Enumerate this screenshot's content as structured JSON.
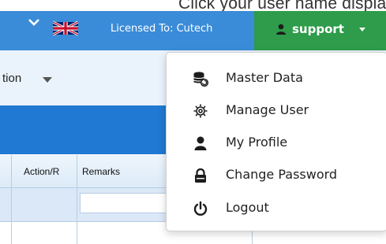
{
  "caption": {
    "text": "Click your user name displayed on"
  },
  "header": {
    "licensed_text": "Licensed To: Cutech",
    "user_label": "support",
    "colors": {
      "topbar": "#3a8cd8",
      "user_button": "#2e9c4a"
    }
  },
  "navbar": {
    "partial_label": "tion"
  },
  "table": {
    "columns": [
      "Action/R",
      "Remarks"
    ]
  },
  "menu": {
    "items": [
      {
        "label": "Master Data",
        "icon": "database-icon"
      },
      {
        "label": "Manage User",
        "icon": "gear-icon"
      },
      {
        "label": "My Profile",
        "icon": "user-icon"
      },
      {
        "label": "Change Password",
        "icon": "lock-icon"
      },
      {
        "label": "Logout",
        "icon": "power-icon"
      }
    ]
  }
}
